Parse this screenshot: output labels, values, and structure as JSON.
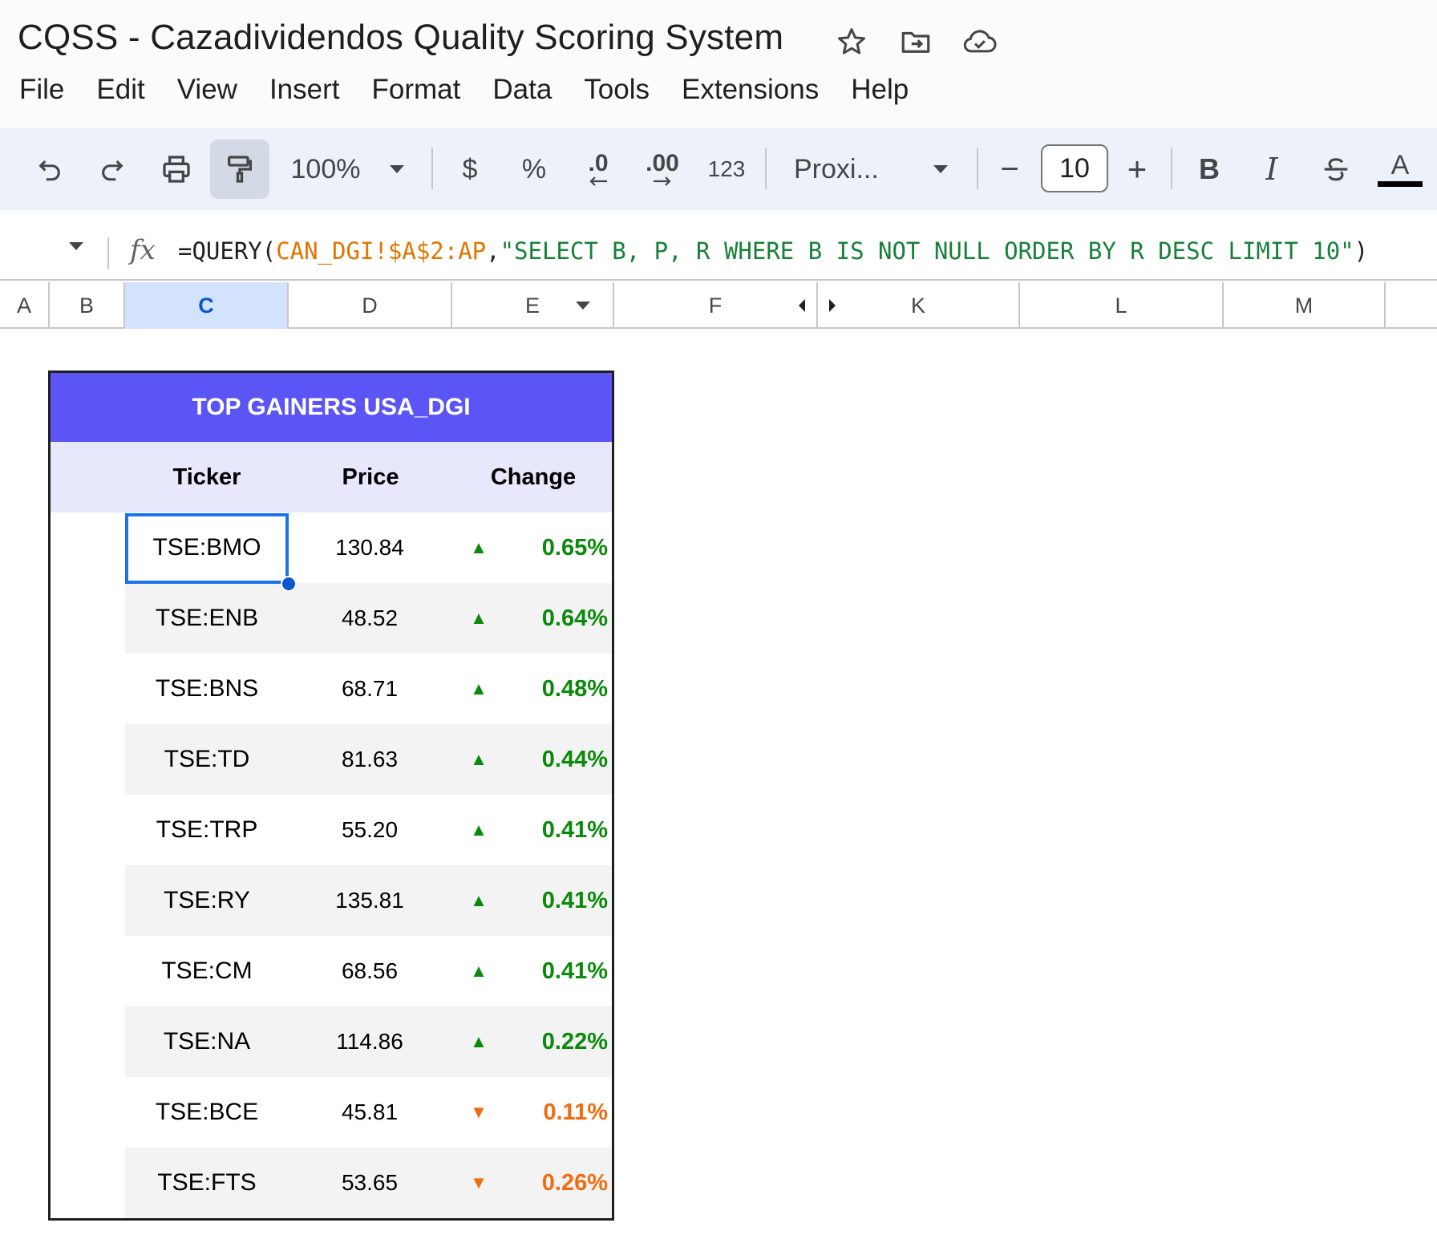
{
  "app": {
    "title": "CQSS - Cazadividendos Quality Scoring  System",
    "title_icons": [
      "star-icon",
      "move-folder-icon",
      "cloud-saved-icon"
    ]
  },
  "menu": [
    "File",
    "Edit",
    "View",
    "Insert",
    "Format",
    "Data",
    "Tools",
    "Extensions",
    "Help"
  ],
  "toolbar": {
    "zoom": "100%",
    "currency": "$",
    "percent": "%",
    "dec_decrease": ".0",
    "dec_increase": ".00",
    "number_format": "123",
    "font": "Proxi...",
    "font_size": "10",
    "minus": "−",
    "plus": "+",
    "bold": "B",
    "italic": "I",
    "text_color": "A"
  },
  "formula_bar": {
    "fx": "fx",
    "prefix": "=QUERY(",
    "range": "CAN_DGI!$A$2:AP",
    "comma": ",",
    "string": "\"SELECT B, P, R WHERE B IS NOT NULL ORDER BY R DESC LIMIT 10\"",
    "suffix": ")"
  },
  "columns": [
    "A",
    "B",
    "C",
    "D",
    "E",
    "F",
    "K",
    "L",
    "M"
  ],
  "selected_column": "C",
  "table": {
    "title": "TOP GAINERS USA_DGI",
    "headers": {
      "ticker": "Ticker",
      "price": "Price",
      "change": "Change"
    },
    "rows": [
      {
        "ticker": "TSE:BMO",
        "price": "130.84",
        "arrow": "▲",
        "change": "0.65%",
        "direction": "up"
      },
      {
        "ticker": "TSE:ENB",
        "price": "48.52",
        "arrow": "▲",
        "change": "0.64%",
        "direction": "up"
      },
      {
        "ticker": "TSE:BNS",
        "price": "68.71",
        "arrow": "▲",
        "change": "0.48%",
        "direction": "up"
      },
      {
        "ticker": "TSE:TD",
        "price": "81.63",
        "arrow": "▲",
        "change": "0.44%",
        "direction": "up"
      },
      {
        "ticker": "TSE:TRP",
        "price": "55.20",
        "arrow": "▲",
        "change": "0.41%",
        "direction": "up"
      },
      {
        "ticker": "TSE:RY",
        "price": "135.81",
        "arrow": "▲",
        "change": "0.41%",
        "direction": "up"
      },
      {
        "ticker": "TSE:CM",
        "price": "68.56",
        "arrow": "▲",
        "change": "0.41%",
        "direction": "up"
      },
      {
        "ticker": "TSE:NA",
        "price": "114.86",
        "arrow": "▲",
        "change": "0.22%",
        "direction": "up"
      },
      {
        "ticker": "TSE:BCE",
        "price": "45.81",
        "arrow": "▼",
        "change": "0.11%",
        "direction": "down"
      },
      {
        "ticker": "TSE:FTS",
        "price": "53.65",
        "arrow": "▼",
        "change": "0.26%",
        "direction": "down"
      }
    ]
  },
  "colors": {
    "title_bg": "#5b55f5",
    "header_bg": "#e8e8fc",
    "up": "#0a8a0a",
    "down": "#f26b0f",
    "selection": "#1a73e8"
  }
}
